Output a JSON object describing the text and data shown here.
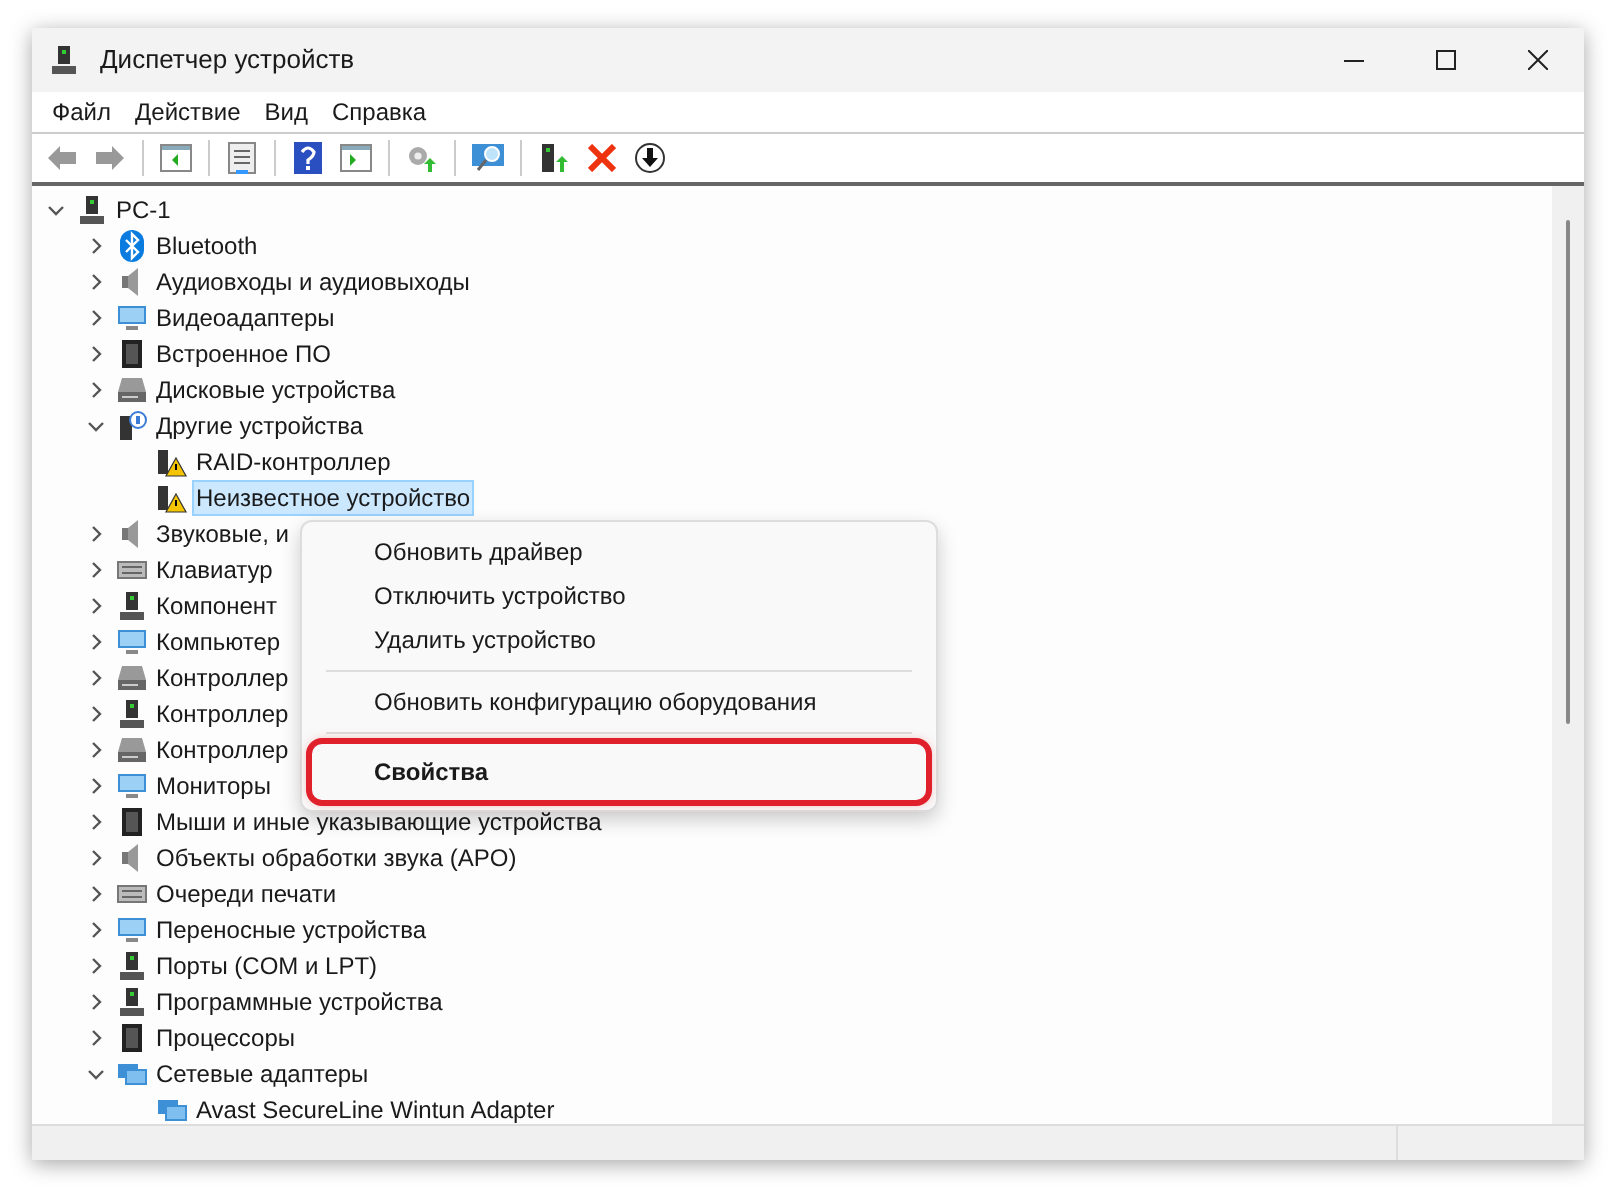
{
  "window": {
    "title": "Диспетчер устройств"
  },
  "menu_bar": [
    "Файл",
    "Действие",
    "Вид",
    "Справка"
  ],
  "tree": [
    {
      "label": "PC-1",
      "expanded": true,
      "selected": false,
      "children": [
        {
          "label": "Bluetooth",
          "expanded": false,
          "selected": false
        },
        {
          "label": "Аудиовходы и аудиовыходы",
          "expanded": false,
          "selected": false
        },
        {
          "label": "Видеоадаптеры",
          "expanded": false,
          "selected": false
        },
        {
          "label": "Встроенное ПО",
          "expanded": false,
          "selected": false
        },
        {
          "label": "Дисковые устройства",
          "expanded": false,
          "selected": false
        },
        {
          "label": "Другие устройства",
          "expanded": true,
          "selected": false,
          "children": [
            {
              "label": "RAID-контроллер",
              "selected": false
            },
            {
              "label": "Неизвестное устройство",
              "selected": true
            }
          ]
        },
        {
          "label": "Звуковые, и",
          "expanded": false,
          "selected": false
        },
        {
          "label": "Клавиатур",
          "expanded": false,
          "selected": false
        },
        {
          "label": "Компонент",
          "expanded": false,
          "selected": false
        },
        {
          "label": "Компьютер",
          "expanded": false,
          "selected": false
        },
        {
          "label": "Контроллер",
          "expanded": false,
          "selected": false
        },
        {
          "label": "Контроллер",
          "expanded": false,
          "selected": false
        },
        {
          "label": "Контроллер",
          "expanded": false,
          "selected": false
        },
        {
          "label": "Мониторы",
          "expanded": false,
          "selected": false
        },
        {
          "label": "Мыши и иные указывающие устройства",
          "expanded": false,
          "selected": false
        },
        {
          "label": "Объекты обработки звука (APO)",
          "expanded": false,
          "selected": false
        },
        {
          "label": "Очереди печати",
          "expanded": false,
          "selected": false
        },
        {
          "label": "Переносные устройства",
          "expanded": false,
          "selected": false
        },
        {
          "label": "Порты (COM и LPT)",
          "expanded": false,
          "selected": false
        },
        {
          "label": "Программные устройства",
          "expanded": false,
          "selected": false
        },
        {
          "label": "Процессоры",
          "expanded": false,
          "selected": false
        },
        {
          "label": "Сетевые адаптеры",
          "expanded": true,
          "selected": false,
          "children": [
            {
              "label": "Avast SecureLine Wintun Adapter",
              "selected": false
            }
          ]
        }
      ]
    }
  ],
  "context_menu": [
    {
      "kind": "item",
      "label": "Обновить драйвер",
      "default": false,
      "highlighted": false
    },
    {
      "kind": "item",
      "label": "Отключить устройство",
      "default": false,
      "highlighted": false
    },
    {
      "kind": "item",
      "label": "Удалить устройство",
      "default": false,
      "highlighted": false
    },
    {
      "kind": "separator"
    },
    {
      "kind": "item",
      "label": "Обновить конфигурацию оборудования",
      "default": false,
      "highlighted": false
    },
    {
      "kind": "separator"
    },
    {
      "kind": "item",
      "label": "Свойства",
      "default": true,
      "highlighted": true
    }
  ]
}
